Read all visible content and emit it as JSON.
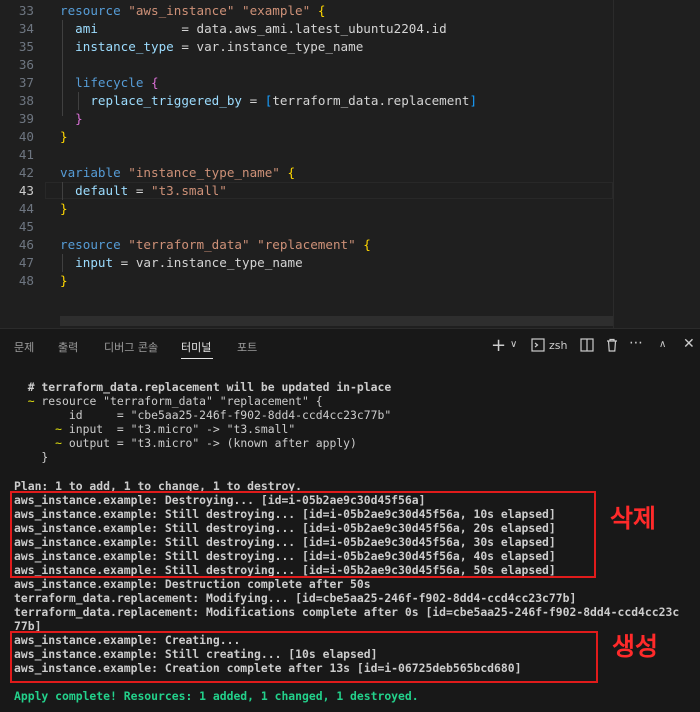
{
  "editor": {
    "lines": [
      {
        "n": "33",
        "parts": [
          [
            "kw",
            "resource "
          ],
          [
            "str",
            "\"aws_instance\" \"example\" "
          ],
          [
            "br1",
            "{"
          ]
        ]
      },
      {
        "n": "34",
        "parts": [
          [
            "plain",
            "  "
          ],
          [
            "attr",
            "ami"
          ],
          [
            "plain",
            "           = data.aws_ami.latest_ubuntu2204.id"
          ]
        ]
      },
      {
        "n": "35",
        "parts": [
          [
            "plain",
            "  "
          ],
          [
            "attr",
            "instance_type"
          ],
          [
            "plain",
            " = var.instance_type_name"
          ]
        ]
      },
      {
        "n": "36",
        "parts": []
      },
      {
        "n": "37",
        "parts": [
          [
            "plain",
            "  "
          ],
          [
            "kw",
            "lifecycle "
          ],
          [
            "br2",
            "{"
          ]
        ]
      },
      {
        "n": "38",
        "parts": [
          [
            "plain",
            "    "
          ],
          [
            "attr",
            "replace_triggered_by"
          ],
          [
            "plain",
            " = "
          ],
          [
            "br3",
            "["
          ],
          [
            "plain",
            "terraform_data.replacement"
          ],
          [
            "br3",
            "]"
          ]
        ]
      },
      {
        "n": "39",
        "parts": [
          [
            "plain",
            "  "
          ],
          [
            "br2",
            "}"
          ]
        ]
      },
      {
        "n": "40",
        "parts": [
          [
            "br1",
            "}"
          ]
        ]
      },
      {
        "n": "41",
        "parts": []
      },
      {
        "n": "42",
        "parts": [
          [
            "kw",
            "variable "
          ],
          [
            "str",
            "\"instance_type_name\" "
          ],
          [
            "br1",
            "{"
          ]
        ]
      },
      {
        "n": "43",
        "parts": [
          [
            "plain",
            "  "
          ],
          [
            "attr",
            "default"
          ],
          [
            "plain",
            " = "
          ],
          [
            "str",
            "\"t3.small\""
          ]
        ]
      },
      {
        "n": "44",
        "parts": [
          [
            "br1",
            "}"
          ]
        ]
      },
      {
        "n": "45",
        "parts": []
      },
      {
        "n": "46",
        "parts": [
          [
            "kw",
            "resource "
          ],
          [
            "str",
            "\"terraform_data\" \"replacement\" "
          ],
          [
            "br1",
            "{"
          ]
        ]
      },
      {
        "n": "47",
        "parts": [
          [
            "plain",
            "  "
          ],
          [
            "attr",
            "input"
          ],
          [
            "plain",
            " = var.instance_type_name"
          ]
        ]
      },
      {
        "n": "48",
        "parts": [
          [
            "br1",
            "}"
          ]
        ]
      }
    ],
    "current_line": "43"
  },
  "panel": {
    "tabs": [
      "문제",
      "출력",
      "디버그 콘솔",
      "터미널",
      "포트"
    ],
    "active_tab": "터미널",
    "shell_label": "zsh",
    "icons": [
      "plus-icon",
      "chevron-down-icon",
      "terminal-icon",
      "split-icon",
      "trash-icon",
      "more-icon",
      "chevron-up-icon",
      "close-icon"
    ]
  },
  "terminal": {
    "lines": [
      {
        "t": "  # terraform_data.replacement will be updated in-place",
        "style": "plan-head"
      },
      {
        "t": "  ~ resource \"terraform_data\" \"replacement\" {",
        "style": "change"
      },
      {
        "t": "        id     = \"cbe5aa25-246f-f902-8dd4-ccd4cc23c77b\"",
        "style": "norm"
      },
      {
        "t": "      ~ input  = \"t3.micro\" -> \"t3.small\"",
        "style": "change"
      },
      {
        "t": "      ~ output = \"t3.micro\" -> (known after apply)",
        "style": "change"
      },
      {
        "t": "    }",
        "style": "norm"
      },
      {
        "t": "",
        "style": "norm"
      },
      {
        "t": "Plan: 1 to add, 1 to change, 1 to destroy.",
        "style": "plan"
      },
      {
        "t": "aws_instance.example: Destroying... [id=i-05b2ae9c30d45f56a]",
        "style": "bold"
      },
      {
        "t": "aws_instance.example: Still destroying... [id=i-05b2ae9c30d45f56a, 10s elapsed]",
        "style": "bold"
      },
      {
        "t": "aws_instance.example: Still destroying... [id=i-05b2ae9c30d45f56a, 20s elapsed]",
        "style": "bold"
      },
      {
        "t": "aws_instance.example: Still destroying... [id=i-05b2ae9c30d45f56a, 30s elapsed]",
        "style": "bold"
      },
      {
        "t": "aws_instance.example: Still destroying... [id=i-05b2ae9c30d45f56a, 40s elapsed]",
        "style": "bold"
      },
      {
        "t": "aws_instance.example: Still destroying... [id=i-05b2ae9c30d45f56a, 50s elapsed]",
        "style": "bold"
      },
      {
        "t": "aws_instance.example: Destruction complete after 50s",
        "style": "bold"
      },
      {
        "t": "terraform_data.replacement: Modifying... [id=cbe5aa25-246f-f902-8dd4-ccd4cc23c77b]",
        "style": "bold"
      },
      {
        "t": "terraform_data.replacement: Modifications complete after 0s [id=cbe5aa25-246f-f902-8dd4-ccd4cc23c",
        "style": "bold"
      },
      {
        "t": "77b]",
        "style": "bold"
      },
      {
        "t": "aws_instance.example: Creating...",
        "style": "bold"
      },
      {
        "t": "aws_instance.example: Still creating... [10s elapsed]",
        "style": "bold"
      },
      {
        "t": "aws_instance.example: Creation complete after 13s [id=i-06725deb565bcd680]",
        "style": "bold"
      },
      {
        "t": "",
        "style": "norm"
      },
      {
        "t": "Apply complete! Resources: 1 added, 1 changed, 1 destroyed.",
        "style": "green"
      }
    ]
  },
  "annotations": {
    "delete_label": "삭제",
    "create_label": "생성",
    "box_color": "#e01b1b"
  }
}
